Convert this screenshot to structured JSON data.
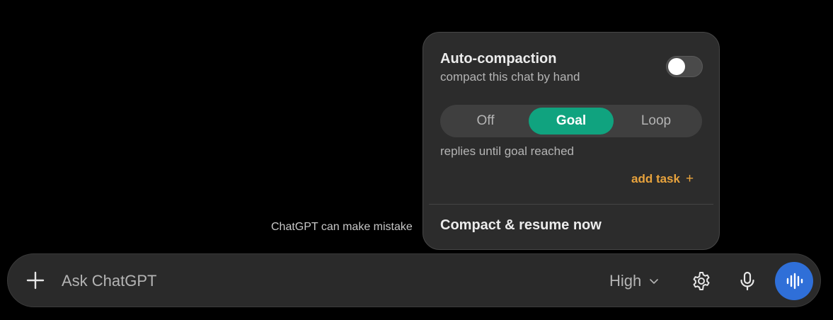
{
  "disclaimer": "ChatGPT can make mistake",
  "composer": {
    "placeholder": "Ask ChatGPT",
    "model_label": "High",
    "icons": {
      "add": "plus-icon",
      "model_dropdown": "chevron-down-icon",
      "settings": "gear-icon",
      "dictate": "microphone-icon",
      "voice": "voice-waveform-icon"
    }
  },
  "popover": {
    "title": "Auto-compaction",
    "subtitle": "compact this chat by hand",
    "toggle_on": false,
    "modes": [
      "Off",
      "Goal",
      "Loop"
    ],
    "selected_mode": "Goal",
    "mode_description": "replies until goal reached",
    "add_task_label": "add task",
    "add_task_icon": "+",
    "compact_now_label": "Compact & resume now"
  },
  "colors": {
    "background": "#000000",
    "panel": "#2c2c2c",
    "accent_green": "#10a37f",
    "accent_orange": "#e8a33d",
    "voice_button": "#2f6fd8"
  }
}
